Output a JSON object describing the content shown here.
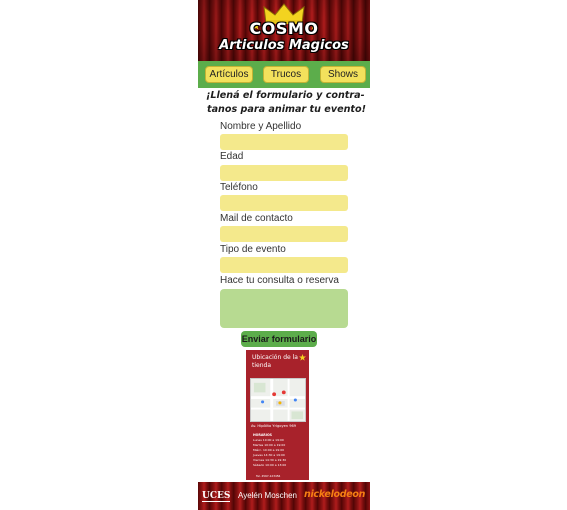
{
  "header": {
    "logo_title": "COSMO",
    "logo_subtitle": "Articulos Magicos"
  },
  "nav": {
    "items": [
      {
        "label": "Artículos"
      },
      {
        "label": "Trucos"
      },
      {
        "label": "Shows"
      }
    ]
  },
  "form": {
    "heading_line1": "¡Llená el formulario y contra-",
    "heading_line2": "tanos para animar tu evento!",
    "fields": [
      {
        "label": "Nombre y Apellido",
        "value": ""
      },
      {
        "label": "Edad",
        "value": ""
      },
      {
        "label": "Teléfono",
        "value": ""
      },
      {
        "label": "Mail de contacto",
        "value": ""
      },
      {
        "label": "Tipo de evento",
        "value": ""
      }
    ],
    "message_label": "Hace tu consulta o reserva",
    "message_value": "",
    "submit_label": "Enviar formulario"
  },
  "store_card": {
    "title_line1": "Ubicación de la",
    "title_line2": "tienda",
    "address": "Av. Hipólito Yrigoyen 969",
    "hours_title": "HORARIOS",
    "hours": [
      "Lunes 10:00 a 19:00",
      "Martes 10:00 a 19:00",
      "Miérc. 10:00 a 19:00",
      "Jueves 14:30 a 19:00",
      "Viernes 14:30 a 19:30",
      "Sábado 10:00 a 13:00"
    ],
    "footer_line": "Tel. 4567-123456"
  },
  "footer": {
    "school": "UCES",
    "author": "Ayelén Moschen",
    "brand": "nickelodeon"
  },
  "colors": {
    "curtain": "#8e1313",
    "nav_green": "#5cad4b",
    "button_yellow": "#f3e15c",
    "field_yellow": "#f4e98c",
    "textarea_green": "#b7da91",
    "brand_orange": "#f57f13",
    "card_red": "#a8222b"
  }
}
